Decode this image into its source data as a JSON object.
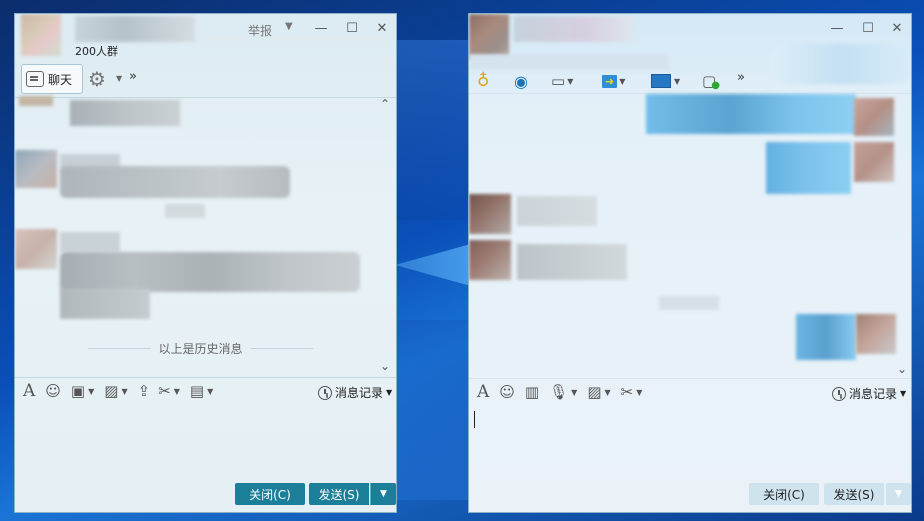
{
  "left_window": {
    "title_actions": {
      "report": "举报"
    },
    "member_count": "200人群",
    "tabs": {
      "chat": "聊天",
      "more": "»"
    },
    "history_divider": "以上是历史消息",
    "toolbar": {
      "message_history": "消息记录"
    },
    "buttons": {
      "close": "关闭(C)",
      "send": "发送(S)"
    }
  },
  "right_window": {
    "toolbar_more": "»",
    "toolbar": {
      "message_history": "消息记录"
    },
    "buttons": {
      "close": "关闭(C)",
      "send": "发送(S)"
    }
  },
  "window_controls": {
    "minimize": "—",
    "maximize": "☐",
    "close": "✕"
  },
  "colors": {
    "accent_button": "#1b7f9a",
    "light_button": "#cfe3ef",
    "bubble_self": "#7fc6ec",
    "desktop": "#0a4fb8"
  }
}
